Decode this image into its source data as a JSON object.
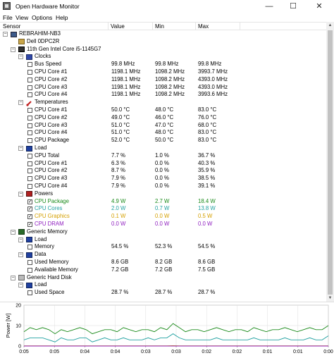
{
  "window": {
    "title": "Open Hardware Monitor",
    "minimize": "—",
    "maximize": "☐",
    "close": "✕"
  },
  "menu": [
    "File",
    "View",
    "Options",
    "Help"
  ],
  "columns": {
    "sensor": "Sensor",
    "value": "Value",
    "min": "Min",
    "max": "Max"
  },
  "tree": [
    {
      "level": 0,
      "exp": "−",
      "icon": "computer",
      "label": "REBRAHIM-NB3"
    },
    {
      "level": 1,
      "icon": "board",
      "label": "Dell 0DPC2R"
    },
    {
      "level": 1,
      "exp": "−",
      "icon": "cpu",
      "label": "11th Gen Intel Core i5-1145G7"
    },
    {
      "level": 2,
      "exp": "−",
      "icon": "clock",
      "label": "Clocks"
    },
    {
      "level": 3,
      "chk": false,
      "label": "Bus Speed",
      "value": "99.8 MHz",
      "min": "99.8 MHz",
      "max": "99.8 MHz"
    },
    {
      "level": 3,
      "chk": false,
      "label": "CPU Core #1",
      "value": "1198.1 MHz",
      "min": "1098.2 MHz",
      "max": "3993.7 MHz"
    },
    {
      "level": 3,
      "chk": false,
      "label": "CPU Core #2",
      "value": "1198.1 MHz",
      "min": "1098.2 MHz",
      "max": "4393.0 MHz"
    },
    {
      "level": 3,
      "chk": false,
      "label": "CPU Core #3",
      "value": "1198.1 MHz",
      "min": "1098.2 MHz",
      "max": "4393.0 MHz"
    },
    {
      "level": 3,
      "chk": false,
      "label": "CPU Core #4",
      "value": "1198.1 MHz",
      "min": "1098.2 MHz",
      "max": "3993.6 MHz"
    },
    {
      "level": 2,
      "exp": "−",
      "icon": "temp",
      "label": "Temperatures"
    },
    {
      "level": 3,
      "chk": false,
      "label": "CPU Core #1",
      "value": "50.0 °C",
      "min": "48.0 °C",
      "max": "83.0 °C"
    },
    {
      "level": 3,
      "chk": false,
      "label": "CPU Core #2",
      "value": "49.0 °C",
      "min": "46.0 °C",
      "max": "76.0 °C"
    },
    {
      "level": 3,
      "chk": false,
      "label": "CPU Core #3",
      "value": "51.0 °C",
      "min": "47.0 °C",
      "max": "68.0 °C"
    },
    {
      "level": 3,
      "chk": false,
      "label": "CPU Core #4",
      "value": "51.0 °C",
      "min": "48.0 °C",
      "max": "83.0 °C"
    },
    {
      "level": 3,
      "chk": false,
      "label": "CPU Package",
      "value": "52.0 °C",
      "min": "50.0 °C",
      "max": "83.0 °C"
    },
    {
      "level": 2,
      "exp": "−",
      "icon": "load",
      "label": "Load"
    },
    {
      "level": 3,
      "chk": false,
      "label": "CPU Total",
      "value": "7.7 %",
      "min": "1.0 %",
      "max": "36.7 %"
    },
    {
      "level": 3,
      "chk": false,
      "label": "CPU Core #1",
      "value": "6.3 %",
      "min": "0.0 %",
      "max": "40.3 %"
    },
    {
      "level": 3,
      "chk": false,
      "label": "CPU Core #2",
      "value": "8.7 %",
      "min": "0.0 %",
      "max": "35.9 %"
    },
    {
      "level": 3,
      "chk": false,
      "label": "CPU Core #3",
      "value": "7.9 %",
      "min": "0.0 %",
      "max": "38.5 %"
    },
    {
      "level": 3,
      "chk": false,
      "label": "CPU Core #4",
      "value": "7.9 %",
      "min": "0.0 %",
      "max": "39.1 %"
    },
    {
      "level": 2,
      "exp": "−",
      "icon": "power",
      "label": "Powers"
    },
    {
      "level": 3,
      "chk": true,
      "label": "CPU Package",
      "value": "4.9 W",
      "min": "2.7 W",
      "max": "18.4 W",
      "color": "#1a8a1a"
    },
    {
      "level": 3,
      "chk": true,
      "label": "CPU Cores",
      "value": "2.0 W",
      "min": "0.7 W",
      "max": "13.8 W",
      "color": "#20a0a0"
    },
    {
      "level": 3,
      "chk": true,
      "label": "CPU Graphics",
      "value": "0.1 W",
      "min": "0.0 W",
      "max": "0.5 W",
      "color": "#d4a000"
    },
    {
      "level": 3,
      "chk": true,
      "label": "CPU DRAM",
      "value": "0.0 W",
      "min": "0.0 W",
      "max": "0.0 W",
      "color": "#9020c0"
    },
    {
      "level": 1,
      "exp": "−",
      "icon": "ram",
      "label": "Generic Memory"
    },
    {
      "level": 2,
      "exp": "−",
      "icon": "load",
      "label": "Load"
    },
    {
      "level": 3,
      "chk": false,
      "label": "Memory",
      "value": "54.5 %",
      "min": "52.3 %",
      "max": "54.5 %"
    },
    {
      "level": 2,
      "exp": "−",
      "icon": "data",
      "label": "Data"
    },
    {
      "level": 3,
      "chk": false,
      "label": "Used Memory",
      "value": "8.6 GB",
      "min": "8.2 GB",
      "max": "8.6 GB"
    },
    {
      "level": 3,
      "chk": false,
      "label": "Available Memory",
      "value": "7.2 GB",
      "min": "7.2 GB",
      "max": "7.5 GB"
    },
    {
      "level": 1,
      "exp": "−",
      "icon": "disk",
      "label": "Generic Hard Disk"
    },
    {
      "level": 2,
      "exp": "−",
      "icon": "load",
      "label": "Load"
    },
    {
      "level": 3,
      "chk": false,
      "label": "Used Space",
      "value": "28.7 %",
      "min": "28.7 %",
      "max": "28.7 %"
    }
  ],
  "chart_data": {
    "type": "line",
    "ylabel": "Power [W]",
    "yticks": [
      "0",
      "10",
      "20"
    ],
    "xticks": [
      "0:05",
      "0:05",
      "0:04",
      "0:04",
      "0:03",
      "0:03",
      "0:02",
      "0:02",
      "0:01",
      "0:01",
      "0:00"
    ],
    "ylim": [
      0,
      20
    ],
    "grid": true,
    "series": [
      {
        "name": "CPU Package",
        "color": "#1a8a1a",
        "values": [
          7,
          9,
          8,
          9,
          8,
          6,
          8,
          7,
          8,
          9,
          8,
          6,
          7,
          8,
          8,
          7,
          9,
          8,
          7,
          8,
          8,
          7,
          9,
          8,
          11,
          9,
          7,
          8,
          8,
          7,
          8,
          9,
          8,
          7,
          8,
          8,
          7,
          9,
          8,
          7,
          8,
          8,
          9,
          8,
          7,
          8,
          9,
          8,
          8,
          10
        ]
      },
      {
        "name": "CPU Cores",
        "color": "#20a0a0",
        "values": [
          3,
          4,
          4,
          4,
          3,
          2,
          4,
          3,
          3,
          4,
          4,
          2,
          3,
          4,
          3,
          3,
          4,
          3,
          3,
          3,
          4,
          3,
          4,
          4,
          6,
          4,
          3,
          3,
          3,
          3,
          3,
          4,
          3,
          3,
          3,
          3,
          3,
          4,
          3,
          3,
          3,
          3,
          4,
          3,
          3,
          3,
          4,
          3,
          3,
          5
        ]
      },
      {
        "name": "CPU Graphics",
        "color": "#d4a000",
        "values": [
          0.1,
          0.1,
          0.1,
          0.1,
          0.1,
          0.1,
          0.1,
          0.1,
          0.1,
          0.1,
          0.1,
          0.1,
          0.1,
          0.1,
          0.1,
          0.1,
          0.1,
          0.1,
          0.1,
          0.1,
          0.1,
          0.1,
          0.1,
          0.1,
          0.2,
          0.1,
          0.1,
          0.1,
          0.1,
          0.1,
          0.1,
          0.1,
          0.1,
          0.1,
          0.1,
          0.1,
          0.1,
          0.1,
          0.1,
          0.1,
          0.1,
          0.1,
          0.1,
          0.1,
          0.1,
          0.1,
          0.1,
          0.1,
          0.1,
          0.1
        ]
      },
      {
        "name": "CPU DRAM",
        "color": "#9020c0",
        "values": [
          0,
          0,
          0,
          0,
          0,
          0,
          0,
          0,
          0,
          0,
          0,
          0,
          0,
          0,
          0,
          0,
          0,
          0,
          0,
          0,
          0,
          0,
          0,
          0,
          0,
          0,
          0,
          0,
          0,
          0,
          0,
          0,
          0,
          0,
          0,
          0,
          0,
          0,
          0,
          0,
          0,
          0,
          0,
          0,
          0,
          0,
          0,
          0,
          0,
          0
        ]
      }
    ]
  }
}
